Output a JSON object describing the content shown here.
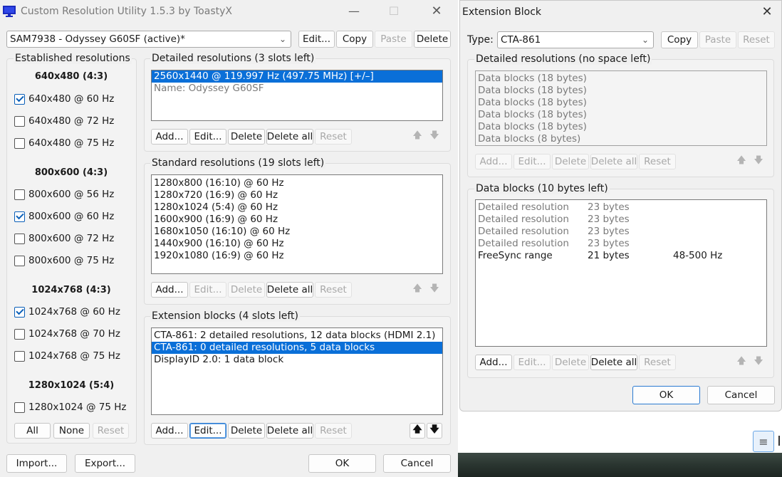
{
  "main_window": {
    "title": "Custom Resolution Utility 1.5.3 by ToastyX",
    "device_value": "SAM7938 - Odyssey G60SF (active)*",
    "buttons": {
      "edit": "Edit...",
      "copy": "Copy",
      "paste": "Paste",
      "delete": "Delete"
    },
    "established": {
      "label": "Established resolutions",
      "groups": [
        {
          "heading": "640x480 (4:3)",
          "items": [
            {
              "label": "640x480 @ 60 Hz",
              "checked": true
            },
            {
              "label": "640x480 @ 72 Hz",
              "checked": false
            },
            {
              "label": "640x480 @ 75 Hz",
              "checked": false
            }
          ]
        },
        {
          "heading": "800x600 (4:3)",
          "items": [
            {
              "label": "800x600 @ 56 Hz",
              "checked": false
            },
            {
              "label": "800x600 @ 60 Hz",
              "checked": true
            },
            {
              "label": "800x600 @ 72 Hz",
              "checked": false
            },
            {
              "label": "800x600 @ 75 Hz",
              "checked": false
            }
          ]
        },
        {
          "heading": "1024x768 (4:3)",
          "items": [
            {
              "label": "1024x768 @ 60 Hz",
              "checked": true
            },
            {
              "label": "1024x768 @ 70 Hz",
              "checked": false
            },
            {
              "label": "1024x768 @ 75 Hz",
              "checked": false
            }
          ]
        },
        {
          "heading": "1280x1024 (5:4)",
          "items": [
            {
              "label": "1280x1024 @ 75 Hz",
              "checked": false
            }
          ]
        }
      ],
      "buttons": {
        "all": "All",
        "none": "None",
        "reset": "Reset"
      }
    },
    "detailed": {
      "label": "Detailed resolutions (3 slots left)",
      "items": [
        "2560x1440 @ 119.997 Hz (497.75 MHz) [+/–]",
        "Name: Odyssey G60SF"
      ]
    },
    "standard": {
      "label": "Standard resolutions (19 slots left)",
      "items": [
        "1280x800 (16:10) @ 60 Hz",
        "1280x720 (16:9) @ 60 Hz",
        "1280x1024 (5:4) @ 60 Hz",
        "1600x900 (16:9) @ 60 Hz",
        "1680x1050 (16:10) @ 60 Hz",
        "1440x900 (16:10) @ 60 Hz",
        "1920x1080 (16:9) @ 60 Hz"
      ]
    },
    "extension": {
      "label": "Extension blocks (4 slots left)",
      "items": [
        "CTA-861: 2 detailed resolutions, 12 data blocks (HDMI 2.1)",
        "CTA-861: 0 detailed resolutions, 5 data blocks",
        "DisplayID 2.0: 1 data block"
      ]
    },
    "list_buttons": {
      "add": "Add...",
      "edit": "Edit...",
      "delete": "Delete",
      "delete_all": "Delete all",
      "reset": "Reset"
    },
    "bottom": {
      "import": "Import...",
      "export": "Export...",
      "ok": "OK",
      "cancel": "Cancel"
    }
  },
  "ext_window": {
    "title": "Extension Block",
    "type_label": "Type:",
    "type_value": "CTA-861",
    "buttons": {
      "copy": "Copy",
      "paste": "Paste",
      "reset": "Reset"
    },
    "detailed": {
      "label": "Detailed resolutions (no space left)",
      "items": [
        "Data blocks (18 bytes)",
        "Data blocks (18 bytes)",
        "Data blocks (18 bytes)",
        "Data blocks (18 bytes)",
        "Data blocks (18 bytes)",
        "Data blocks (8 bytes)"
      ]
    },
    "datablocks": {
      "label": "Data blocks (10 bytes left)",
      "rows": [
        {
          "name": "Detailed resolution",
          "size": "23 bytes",
          "info": ""
        },
        {
          "name": "Detailed resolution",
          "size": "23 bytes",
          "info": ""
        },
        {
          "name": "Detailed resolution",
          "size": "23 bytes",
          "info": ""
        },
        {
          "name": "Detailed resolution",
          "size": "23 bytes",
          "info": ""
        },
        {
          "name": "FreeSync range",
          "size": "21 bytes",
          "info": "48-500 Hz"
        }
      ]
    },
    "list_buttons": {
      "add": "Add...",
      "edit": "Edit...",
      "delete": "Delete",
      "delete_all": "Delete all",
      "reset": "Reset"
    },
    "bottom": {
      "ok": "OK",
      "cancel": "Cancel"
    }
  },
  "icons": {
    "close": "close-icon",
    "minimize": "minimize-icon",
    "maximize": "maximize-icon",
    "monitor": "monitor-icon",
    "up": "arrow-up-icon",
    "down": "arrow-down-icon",
    "chevron": "chevron-down-icon",
    "taskbar": "list-icon"
  },
  "colors": {
    "selection": "#0a6fd8",
    "focus_border": "#2a7ad1",
    "window_bg": "#f0f0f0"
  }
}
